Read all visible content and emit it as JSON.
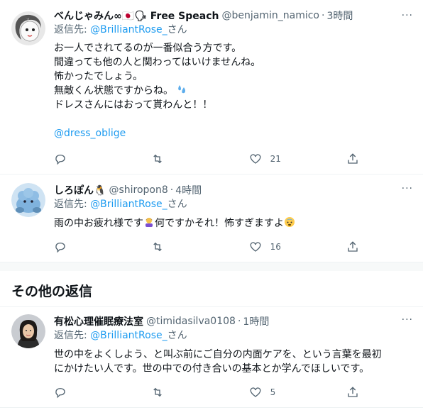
{
  "tweets": [
    {
      "name": "べんじゃみん∞🇯🇵🗣 Free Speach",
      "handle": "@benjamin_namico",
      "time": "3時間",
      "reply_prefix": "返信先: ",
      "reply_mention": "@BrilliantRose_",
      "reply_suffix": "さん",
      "lines": [
        "お一人でされてるのが一番似合う方です。",
        "間違っても他の人と関わってはいけませんね。",
        "怖かったでしょう。",
        "無敵くん状態ですからね。",
        "ドレスさんにはおって貰わんと！！"
      ],
      "link": "@dress_oblige",
      "likes": "21"
    },
    {
      "name": "しろぽん🐧",
      "handle": "@shiropon8",
      "time": "4時間",
      "reply_prefix": "返信先: ",
      "reply_mention": "@BrilliantRose_",
      "reply_suffix": "さん",
      "text_a": "雨の中お疲れ様です",
      "text_b": "何ですかそれ！怖すぎますよ",
      "likes": "16"
    },
    {
      "name": "有松心理催眠療法室",
      "handle": "@timidasilva0108",
      "time": "1時間",
      "reply_prefix": "返信先: ",
      "reply_mention": "@BrilliantRose_",
      "reply_suffix": "さん",
      "lines": [
        "世の中をよくしよう、と叫ぶ前にご自分の内面ケアを、という言葉を最初",
        "にかけたい人です。世の中での付き合いの基本とか学んでほしいです。"
      ],
      "likes": "5"
    }
  ],
  "section_title": "その他の返信",
  "more_label": "···",
  "dot": "·",
  "colors": {
    "link": "#1d9bf0",
    "muted": "#536471",
    "text": "#0f1419"
  }
}
